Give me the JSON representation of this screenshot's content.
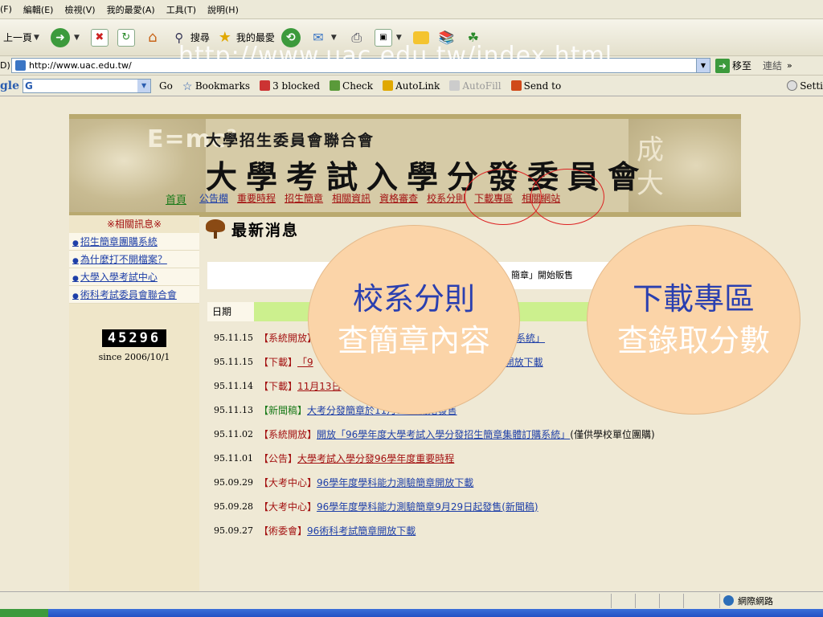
{
  "browser": {
    "menu": [
      "(F)",
      "編輯(E)",
      "檢視(V)",
      "我的最愛(A)",
      "工具(T)",
      "說明(H)"
    ],
    "toolbar": {
      "back": "上一頁",
      "search": "搜尋",
      "favorites": "我的最愛"
    },
    "address": {
      "label": "D)",
      "url": "http://www.uac.edu.tw/",
      "go": "移至",
      "links": "連結"
    },
    "google_toolbar": {
      "logo": "gle",
      "search_value": "G",
      "go": "Go",
      "bookmarks": "Bookmarks",
      "blocked": "3 blocked",
      "check": "Check",
      "autolink": "AutoLink",
      "autofill": "AutoFill",
      "send_to": "Send to",
      "settings": "Setti"
    },
    "status": {
      "zone": "網際網路"
    }
  },
  "overlay": {
    "watermark": "http://www.uac.edu.tw/index.html",
    "bubble_left": {
      "line1": "校系分則",
      "line2": "查簡章內容"
    },
    "bubble_right": {
      "line1": "下載專區",
      "line2": "查錄取分數"
    }
  },
  "banner": {
    "emc": "E=mc²",
    "subtitle": "大學招生委員會聯合會",
    "title": "大學考試入學分發委員會",
    "right_text": "成大",
    "nav": {
      "home": "首頁",
      "items": [
        "公告欄",
        "重要時程",
        "招生簡章",
        "相關資訊",
        "資格審查",
        "校系分則",
        "下載專區",
        "相關網站"
      ]
    }
  },
  "sidebar": {
    "header": "※相關訊息※",
    "links": [
      "招生簡章團購系統",
      "為什麼打不開檔案？",
      "大學入學考試中心",
      "術科考試委員會聯合會"
    ],
    "counter": "45296",
    "since": "since 2006/10/1"
  },
  "news": {
    "title": "最新消息",
    "banner_text": "簡章」開始販售",
    "date_header": "日期",
    "items": [
      {
        "date": "95.11.15",
        "category": "【系統開放】",
        "link": "簡系統」",
        "note": ""
      },
      {
        "date": "95.11.15",
        "category": "【下載】",
        "link": "「9",
        "note": "開放下載"
      },
      {
        "date": "95.11.14",
        "category": "【下載】",
        "link": "11月13日",
        "note": ""
      },
      {
        "date": "95.11.13",
        "category": "【新聞稿】",
        "link": "大考分發簡章於11月15日開始發售",
        "note": ""
      },
      {
        "date": "95.11.02",
        "category": "【系統開放】",
        "link": "開放「96學年度大學考試入學分發招生簡章集體訂購系統」",
        "note": "(僅供學校單位團購)"
      },
      {
        "date": "95.11.01",
        "category": "【公告】",
        "link": "大學考試入學分發96學年度重要時程",
        "note": ""
      },
      {
        "date": "95.09.29",
        "category": "【大考中心】",
        "link": "96學年度學科能力測驗簡章開放下載",
        "note": ""
      },
      {
        "date": "95.09.28",
        "category": "【大考中心】",
        "link": "96學年度學科能力測驗簡章9月29日起發售(新聞稿)",
        "note": ""
      },
      {
        "date": "95.09.27",
        "category": "【術委會】",
        "link": "96術科考試簡章開放下載",
        "note": ""
      }
    ]
  },
  "colors": {
    "nav_red": "#a31111",
    "link_blue": "#1e3fa8",
    "bubble_fill": "#fbd4a8",
    "bubble_text_blue": "#2a3fb0",
    "date_bar": "#ccf08e"
  }
}
